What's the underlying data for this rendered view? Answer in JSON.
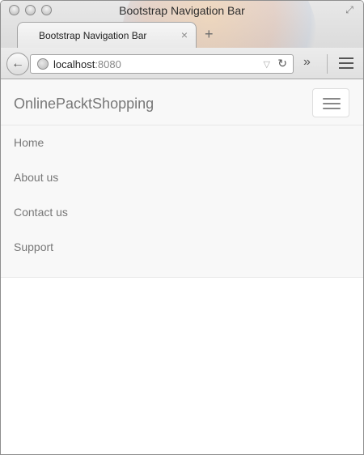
{
  "window": {
    "title": "Bootstrap Navigation Bar"
  },
  "tabs": [
    {
      "label": "Bootstrap Navigation Bar",
      "close_label": "×"
    }
  ],
  "new_tab_label": "+",
  "toolbar": {
    "back_label": "←",
    "url_host": "localhost",
    "url_port": ":8080",
    "overflow_label": "»"
  },
  "page": {
    "brand": "OnlinePacktShopping",
    "nav_items": [
      "Home",
      "About us",
      "Contact us",
      "Support"
    ]
  },
  "colors": {
    "navbar_bg": "#f8f8f8",
    "navbar_border": "#e7e7e7",
    "link_color": "#777777"
  }
}
